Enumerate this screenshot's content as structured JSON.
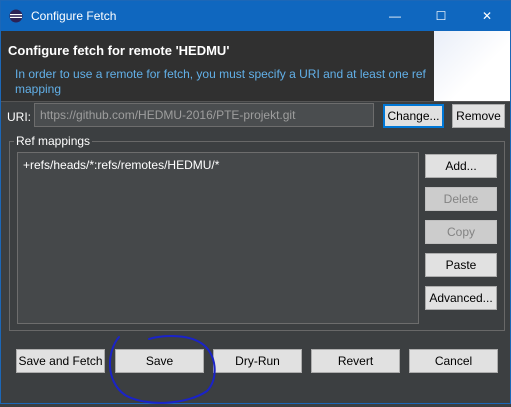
{
  "window": {
    "title": "Configure Fetch",
    "controls": {
      "minimize": "—",
      "maximize": "☐",
      "close": "✕"
    }
  },
  "header": {
    "title": "Configure fetch for remote 'HEDMU'",
    "message": "In order to use a remote for fetch, you must specify a URI and at least one ref mapping"
  },
  "uri": {
    "label": "URI:",
    "value": "https://github.com/HEDMU-2016/PTE-projekt.git",
    "change_button": "Change...",
    "remove_button": "Remove"
  },
  "ref_mappings": {
    "group_label": "Ref mappings",
    "items": [
      "+refs/heads/*:refs/remotes/HEDMU/*"
    ],
    "buttons": {
      "add": "Add...",
      "delete": "Delete",
      "copy": "Copy",
      "paste": "Paste",
      "advanced": "Advanced..."
    }
  },
  "footer": {
    "save_and_fetch": "Save and Fetch",
    "save": "Save",
    "dry_run": "Dry-Run",
    "revert": "Revert",
    "cancel": "Cancel"
  },
  "colors": {
    "title_bar": "#0f67bf",
    "dialog_bg": "#3c3f41",
    "info_text": "#62b0e8",
    "annotation": "#1a23c8"
  }
}
